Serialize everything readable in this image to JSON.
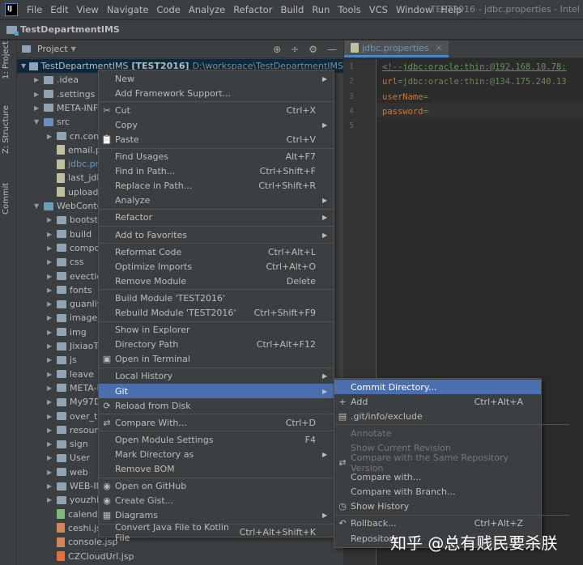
{
  "window_title": "TEST2016 - jdbc.properties - Intel",
  "menubar": [
    "File",
    "Edit",
    "View",
    "Navigate",
    "Code",
    "Analyze",
    "Refactor",
    "Build",
    "Run",
    "Tools",
    "VCS",
    "Window",
    "Help"
  ],
  "navbar": {
    "project": "TestDepartmentIMS"
  },
  "side_tabs": [
    "1: Project",
    "Z: Structure",
    "Commit"
  ],
  "project_panel": {
    "title": "Project",
    "tools": [
      "⊕",
      "÷",
      "⚙",
      "—"
    ]
  },
  "tree": {
    "root_name": "TestDepartmentIMS",
    "root_module": "[TEST2016]",
    "root_path": "D:\\workspace\\TestDepartmentIMS",
    "rows": [
      {
        "label": ".idea",
        "arrow": "▶",
        "icon": "pkg",
        "indent": 1
      },
      {
        "label": ".settings",
        "arrow": "▶",
        "icon": "pkg",
        "indent": 1
      },
      {
        "label": "META-INF",
        "arrow": "▶",
        "icon": "pkg",
        "indent": 1
      },
      {
        "label": "src",
        "arrow": "▼",
        "icon": "src",
        "indent": 1
      },
      {
        "label": "cn.com.",
        "arrow": "▶",
        "icon": "pkg",
        "indent": 2
      },
      {
        "label": "email.p",
        "arrow": "",
        "icon": "file",
        "indent": 2
      },
      {
        "label": "jdbc.pro",
        "arrow": "",
        "icon": "file",
        "indent": 2,
        "blue": true
      },
      {
        "label": "last_jdb",
        "arrow": "",
        "icon": "file",
        "indent": 2
      },
      {
        "label": "upload",
        "arrow": "",
        "icon": "file",
        "indent": 2
      },
      {
        "label": "WebContent",
        "arrow": "▼",
        "icon": "web",
        "indent": 1
      },
      {
        "label": "bootstr",
        "arrow": "▶",
        "icon": "pkg",
        "indent": 2
      },
      {
        "label": "build",
        "arrow": "▶",
        "icon": "pkg",
        "indent": 2
      },
      {
        "label": "compor",
        "arrow": "▶",
        "icon": "pkg",
        "indent": 2
      },
      {
        "label": "css",
        "arrow": "▶",
        "icon": "pkg",
        "indent": 2
      },
      {
        "label": "evection",
        "arrow": "▶",
        "icon": "pkg",
        "indent": 2
      },
      {
        "label": "fonts",
        "arrow": "▶",
        "icon": "pkg",
        "indent": 2
      },
      {
        "label": "guanliy",
        "arrow": "▶",
        "icon": "pkg",
        "indent": 2
      },
      {
        "label": "images",
        "arrow": "▶",
        "icon": "pkg",
        "indent": 2
      },
      {
        "label": "img",
        "arrow": "▶",
        "icon": "pkg",
        "indent": 2
      },
      {
        "label": "JixiaoTe",
        "arrow": "▶",
        "icon": "pkg",
        "indent": 2
      },
      {
        "label": "js",
        "arrow": "▶",
        "icon": "pkg",
        "indent": 2
      },
      {
        "label": "leave",
        "arrow": "▶",
        "icon": "pkg",
        "indent": 2
      },
      {
        "label": "META-I",
        "arrow": "▶",
        "icon": "pkg",
        "indent": 2
      },
      {
        "label": "My97Da",
        "arrow": "▶",
        "icon": "pkg",
        "indent": 2
      },
      {
        "label": "over_tin",
        "arrow": "▶",
        "icon": "pkg",
        "indent": 2
      },
      {
        "label": "resourc",
        "arrow": "▶",
        "icon": "pkg",
        "indent": 2
      },
      {
        "label": "sign",
        "arrow": "▶",
        "icon": "pkg",
        "indent": 2
      },
      {
        "label": "User",
        "arrow": "▶",
        "icon": "pkg",
        "indent": 2
      },
      {
        "label": "web",
        "arrow": "▶",
        "icon": "pkg",
        "indent": 2
      },
      {
        "label": "WEB-IN",
        "arrow": "▶",
        "icon": "pkg",
        "indent": 2
      },
      {
        "label": "youzhis",
        "arrow": "▶",
        "icon": "pkg",
        "indent": 2
      },
      {
        "label": "calenda",
        "arrow": "",
        "icon": "class",
        "indent": 2
      },
      {
        "label": "ceshi.jsp",
        "arrow": "",
        "icon": "jsp",
        "indent": 2
      },
      {
        "label": "console.jsp",
        "arrow": "",
        "icon": "jsp",
        "indent": 2
      },
      {
        "label": "CZCloudUrl.jsp",
        "arrow": "",
        "icon": "html",
        "indent": 2
      }
    ]
  },
  "editor": {
    "tab_label": "jdbc.properties",
    "tab_close": "×",
    "lines": [
      {
        "num": "1",
        "parts": [
          {
            "t": "<!--jdbc:oracle:thin:@192.168.10.78:",
            "c": "code-comment"
          }
        ]
      },
      {
        "num": "2",
        "parts": [
          {
            "t": "url",
            "c": "code-key"
          },
          {
            "t": "=jdbc:oracle:thin:@134.175.240.13",
            "c": "code-val"
          }
        ]
      },
      {
        "num": "3",
        "parts": [
          {
            "t": "userName",
            "c": "code-key"
          },
          {
            "t": "=",
            "c": "code-val"
          }
        ]
      },
      {
        "num": "4",
        "parts": [
          {
            "t": "password",
            "c": "code-key"
          },
          {
            "t": "=",
            "c": "code-val"
          }
        ]
      },
      {
        "num": "5",
        "parts": []
      }
    ]
  },
  "context_menu": [
    {
      "label": "New",
      "shortcut": "",
      "sub": true,
      "icon": ""
    },
    {
      "label": "Add Framework Support...",
      "shortcut": "",
      "sub": false,
      "icon": ""
    },
    {
      "sep": true
    },
    {
      "label": "Cut",
      "shortcut": "Ctrl+X",
      "sub": false,
      "icon": "✂"
    },
    {
      "label": "Copy",
      "shortcut": "",
      "sub": true,
      "icon": ""
    },
    {
      "label": "Paste",
      "shortcut": "Ctrl+V",
      "sub": false,
      "icon": "📋"
    },
    {
      "sep": true
    },
    {
      "label": "Find Usages",
      "shortcut": "Alt+F7",
      "sub": false,
      "icon": ""
    },
    {
      "label": "Find in Path...",
      "shortcut": "Ctrl+Shift+F",
      "sub": false,
      "icon": ""
    },
    {
      "label": "Replace in Path...",
      "shortcut": "Ctrl+Shift+R",
      "sub": false,
      "icon": ""
    },
    {
      "label": "Analyze",
      "shortcut": "",
      "sub": true,
      "icon": ""
    },
    {
      "sep": true
    },
    {
      "label": "Refactor",
      "shortcut": "",
      "sub": true,
      "icon": ""
    },
    {
      "sep": true
    },
    {
      "label": "Add to Favorites",
      "shortcut": "",
      "sub": true,
      "icon": ""
    },
    {
      "sep": true
    },
    {
      "label": "Reformat Code",
      "shortcut": "Ctrl+Alt+L",
      "sub": false,
      "icon": ""
    },
    {
      "label": "Optimize Imports",
      "shortcut": "Ctrl+Alt+O",
      "sub": false,
      "icon": ""
    },
    {
      "label": "Remove Module",
      "shortcut": "Delete",
      "sub": false,
      "icon": ""
    },
    {
      "sep": true
    },
    {
      "label": "Build Module 'TEST2016'",
      "shortcut": "",
      "sub": false,
      "icon": ""
    },
    {
      "label": "Rebuild Module 'TEST2016'",
      "shortcut": "Ctrl+Shift+F9",
      "sub": false,
      "icon": ""
    },
    {
      "sep": true
    },
    {
      "label": "Show in Explorer",
      "shortcut": "",
      "sub": false,
      "icon": ""
    },
    {
      "label": "Directory Path",
      "shortcut": "Ctrl+Alt+F12",
      "sub": false,
      "icon": ""
    },
    {
      "label": "Open in Terminal",
      "shortcut": "",
      "sub": false,
      "icon": "▣"
    },
    {
      "sep": true
    },
    {
      "label": "Local History",
      "shortcut": "",
      "sub": true,
      "icon": ""
    },
    {
      "label": "Git",
      "shortcut": "",
      "sub": true,
      "icon": "",
      "active": true
    },
    {
      "label": "Reload from Disk",
      "shortcut": "",
      "sub": false,
      "icon": "⟳"
    },
    {
      "sep": true
    },
    {
      "label": "Compare With...",
      "shortcut": "Ctrl+D",
      "sub": false,
      "icon": "⇄"
    },
    {
      "sep": true
    },
    {
      "label": "Open Module Settings",
      "shortcut": "F4",
      "sub": false,
      "icon": ""
    },
    {
      "label": "Mark Directory as",
      "shortcut": "",
      "sub": true,
      "icon": ""
    },
    {
      "label": "Remove BOM",
      "shortcut": "",
      "sub": false,
      "icon": ""
    },
    {
      "sep": true
    },
    {
      "label": "Open on GitHub",
      "shortcut": "",
      "sub": false,
      "icon": "◉"
    },
    {
      "label": "Create Gist...",
      "shortcut": "",
      "sub": false,
      "icon": "◉"
    },
    {
      "label": "Diagrams",
      "shortcut": "",
      "sub": true,
      "icon": "▦"
    },
    {
      "sep": true
    },
    {
      "label": "Convert Java File to Kotlin File",
      "shortcut": "Ctrl+Alt+Shift+K",
      "sub": false,
      "icon": ""
    }
  ],
  "git_menu": [
    {
      "label": "Commit Directory...",
      "shortcut": "",
      "icon": "",
      "active": true
    },
    {
      "label": "Add",
      "shortcut": "Ctrl+Alt+A",
      "icon": "+"
    },
    {
      "label": ".git/info/exclude",
      "shortcut": "",
      "icon": "▤"
    },
    {
      "sep": true
    },
    {
      "label": "Annotate",
      "shortcut": "",
      "icon": "",
      "disabled": true
    },
    {
      "label": "Show Current Revision",
      "shortcut": "",
      "icon": "",
      "disabled": true
    },
    {
      "label": "Compare with the Same Repository Version",
      "shortcut": "",
      "icon": "⇄",
      "disabled": true
    },
    {
      "label": "Compare with...",
      "shortcut": "",
      "icon": ""
    },
    {
      "label": "Compare with Branch...",
      "shortcut": "",
      "icon": ""
    },
    {
      "label": "Show History",
      "shortcut": "",
      "icon": "◷"
    },
    {
      "sep": true
    },
    {
      "label": "Rollback...",
      "shortcut": "Ctrl+Alt+Z",
      "icon": "↶"
    },
    {
      "label": "Repository",
      "shortcut": "",
      "icon": ""
    }
  ],
  "watermark": "知乎 @总有贱民要杀朕"
}
